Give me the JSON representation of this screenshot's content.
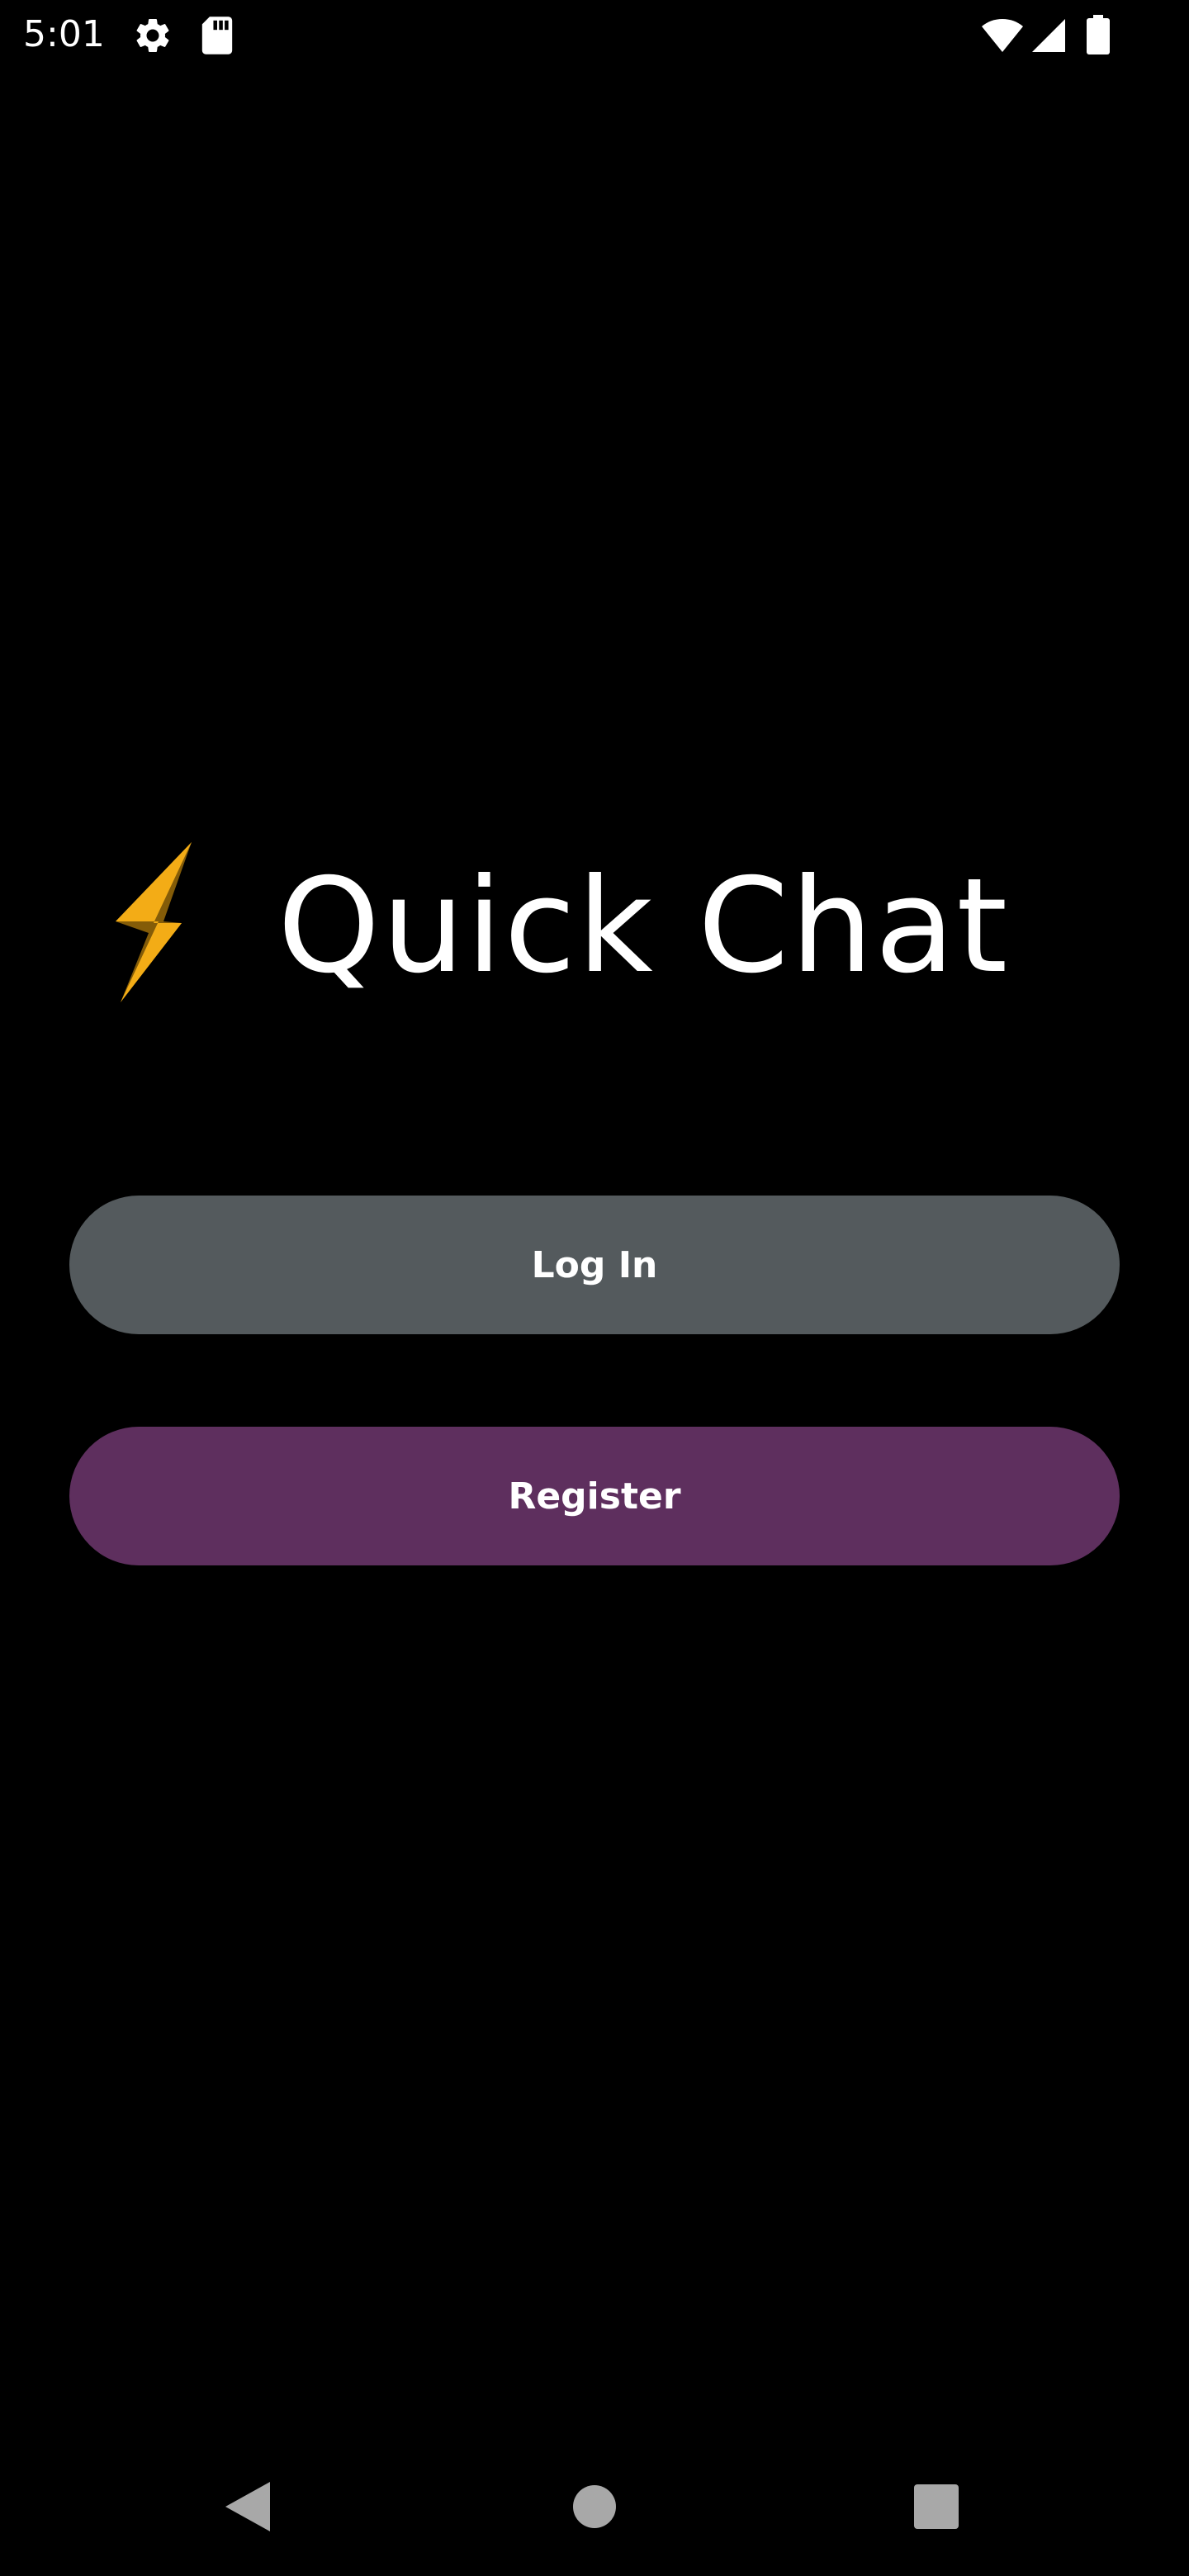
{
  "status_bar": {
    "time": "5:01",
    "left_icons": [
      "gear-icon",
      "sd-card-icon"
    ],
    "right_icons": [
      "wifi-icon",
      "cellular-signal-icon",
      "battery-icon"
    ]
  },
  "app": {
    "title": "Quick Chat",
    "logo_icon": "lightning-bolt-icon",
    "logo_color": "#f5b21f"
  },
  "buttons": {
    "login_label": "Log In",
    "login_color": "#545a5d",
    "register_label": "Register",
    "register_color": "#5e2f5e"
  },
  "nav_bar": {
    "items": [
      "back-icon",
      "home-icon",
      "recents-icon"
    ]
  }
}
